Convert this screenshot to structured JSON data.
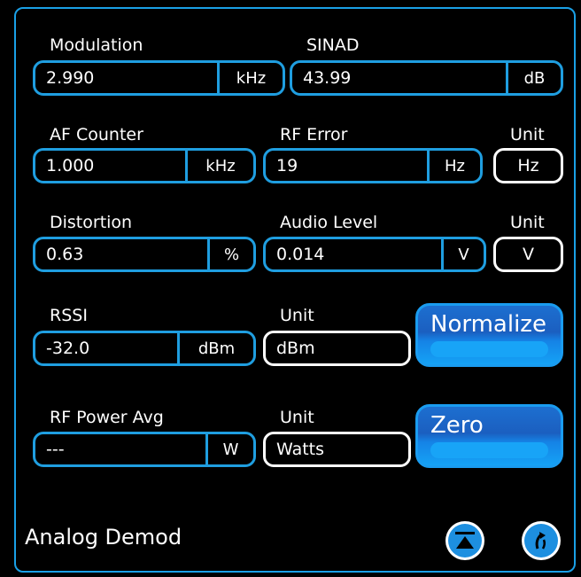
{
  "panel_title": "Analog Demod",
  "measurements": {
    "modulation": {
      "label": "Modulation",
      "value": "2.990",
      "unit": "kHz"
    },
    "sinad": {
      "label": "SINAD",
      "value": "43.99",
      "unit": "dB"
    },
    "af_counter": {
      "label": "AF Counter",
      "value": "1.000",
      "unit": "kHz"
    },
    "rf_error": {
      "label": "RF Error",
      "value": "19",
      "unit": "Hz"
    },
    "rf_error_unit": {
      "label": "Unit",
      "value": "Hz"
    },
    "distortion": {
      "label": "Distortion",
      "value": "0.63",
      "unit": "%"
    },
    "audio_level": {
      "label": "Audio Level",
      "value": "0.014",
      "unit": "V"
    },
    "audio_level_unit": {
      "label": "Unit",
      "value": "V"
    },
    "rssi": {
      "label": "RSSI",
      "value": "-32.0",
      "unit": "dBm"
    },
    "rssi_unit": {
      "label": "Unit",
      "value": "dBm"
    },
    "rf_power_avg": {
      "label": "RF Power Avg",
      "value": "---",
      "unit": "W"
    },
    "rf_power_unit": {
      "label": "Unit",
      "value": "Watts"
    }
  },
  "buttons": {
    "normalize": "Normalize",
    "zero": "Zero"
  },
  "icons": {
    "collapse": "eject-up-icon",
    "refresh": "refresh-icon"
  },
  "colors": {
    "accent": "#1f9ee0",
    "button": "#1b5fc0"
  }
}
